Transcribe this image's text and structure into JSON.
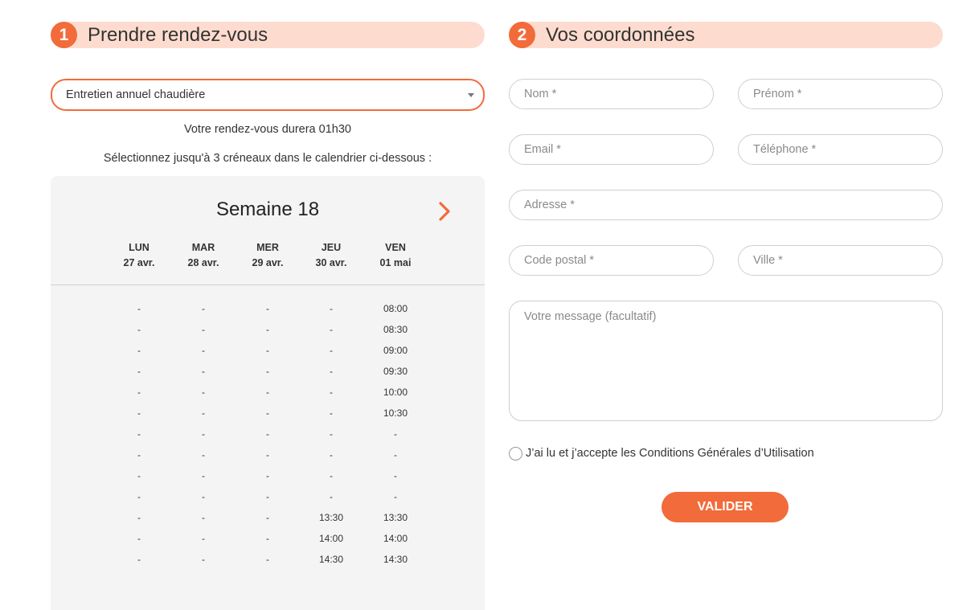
{
  "booking": {
    "step": "1",
    "title": "Prendre rendez-vous",
    "service_select": {
      "value": "Entretien annuel chaudière"
    },
    "duration_text": "Votre rendez-vous durera 01h30",
    "instruction": "Sélectionnez jusqu'à 3 créneaux dans le calendrier ci-dessous :",
    "calendar": {
      "week_title": "Semaine 18",
      "next_icon": "chevron-right-icon",
      "days": [
        {
          "name": "LUN",
          "date": "27 avr."
        },
        {
          "name": "MAR",
          "date": "28 avr."
        },
        {
          "name": "MER",
          "date": "29 avr."
        },
        {
          "name": "JEU",
          "date": "30 avr."
        },
        {
          "name": "VEN",
          "date": "01 mai"
        }
      ],
      "slots": [
        [
          "-",
          "-",
          "-",
          "-",
          "08:00"
        ],
        [
          "-",
          "-",
          "-",
          "-",
          "08:30"
        ],
        [
          "-",
          "-",
          "-",
          "-",
          "09:00"
        ],
        [
          "-",
          "-",
          "-",
          "-",
          "09:30"
        ],
        [
          "-",
          "-",
          "-",
          "-",
          "10:00"
        ],
        [
          "-",
          "-",
          "-",
          "-",
          "10:30"
        ],
        [
          "-",
          "-",
          "-",
          "-",
          "-"
        ],
        [
          "-",
          "-",
          "-",
          "-",
          "-"
        ],
        [
          "-",
          "-",
          "-",
          "-",
          "-"
        ],
        [
          "-",
          "-",
          "-",
          "-",
          "-"
        ],
        [
          "-",
          "-",
          "-",
          "13:30",
          "13:30"
        ],
        [
          "-",
          "-",
          "-",
          "14:00",
          "14:00"
        ],
        [
          "-",
          "-",
          "-",
          "14:30",
          "14:30"
        ]
      ]
    }
  },
  "contact": {
    "step": "2",
    "title": "Vos coordonnées",
    "fields": {
      "nom": "Nom *",
      "prenom": "Prénom *",
      "email": "Email *",
      "telephone": "Téléphone *",
      "adresse": "Adresse *",
      "code_postal": "Code postal *",
      "ville": "Ville *",
      "message": "Votre message (facultatif)"
    },
    "terms_label": "J’ai lu et j’accepte les Conditions Générales d’Utilisation",
    "submit_label": "VALIDER"
  },
  "colors": {
    "accent": "#f26b3a",
    "header_bg": "#fddccf",
    "calendar_bg": "#f4f4f4"
  }
}
